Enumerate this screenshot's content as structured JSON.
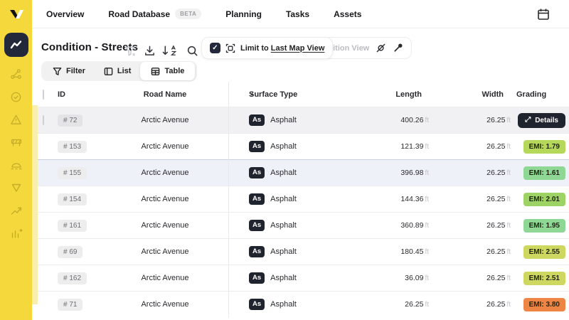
{
  "nav": {
    "items": [
      {
        "label": "Overview"
      },
      {
        "label": "Road Database",
        "badge": "BETA"
      },
      {
        "label": "Planning"
      },
      {
        "label": "Tasks"
      },
      {
        "label": "Assets"
      }
    ]
  },
  "sidebar": {
    "icons": [
      "condition-chart",
      "share-nodes",
      "check-circle",
      "warning-triangle",
      "road-barrier",
      "speed-bump",
      "cone",
      "route",
      "chart-add"
    ]
  },
  "toolbar": {
    "title": "Condition - Streets",
    "limit_toggle": {
      "checked": true,
      "prefix": "Limit to ",
      "link": "Last Map View"
    },
    "condition_view": {
      "label": "Condition View"
    }
  },
  "tabs": {
    "items": [
      {
        "label": "Filter"
      },
      {
        "label": "List"
      },
      {
        "label": "Table"
      }
    ],
    "active_index": 2
  },
  "table": {
    "columns": {
      "id": "ID",
      "road_name": "Road Name",
      "surface_type": "Surface Type",
      "length": "Length",
      "width": "Width",
      "grading": "Grading"
    },
    "unit": "ft",
    "rows": [
      {
        "id": "# 72",
        "road_name": "Arctic Avenue",
        "surface_code": "As",
        "surface": "Asphalt",
        "length": "400.26",
        "width": "26.25",
        "action": "Details",
        "state": "hover",
        "checkbox": true
      },
      {
        "id": "# 153",
        "road_name": "Arctic Avenue",
        "surface_code": "As",
        "surface": "Asphalt",
        "length": "121.39",
        "width": "26.25",
        "emi": "EMI: 1.79",
        "emi_color": "#b6d85a",
        "state": "default"
      },
      {
        "id": "# 155",
        "road_name": "Arctic Avenue",
        "surface_code": "As",
        "surface": "Asphalt",
        "length": "396.98",
        "width": "26.25",
        "emi": "EMI: 1.61",
        "emi_color": "#8ed795",
        "state": "selected"
      },
      {
        "id": "# 154",
        "road_name": "Arctic Avenue",
        "surface_code": "As",
        "surface": "Asphalt",
        "length": "144.36",
        "width": "26.25",
        "emi": "EMI: 2.01",
        "emi_color": "#9dd365",
        "state": "default"
      },
      {
        "id": "# 161",
        "road_name": "Arctic Avenue",
        "surface_code": "As",
        "surface": "Asphalt",
        "length": "360.89",
        "width": "26.25",
        "emi": "EMI: 1.95",
        "emi_color": "#8ed795",
        "state": "default"
      },
      {
        "id": "# 69",
        "road_name": "Arctic Avenue",
        "surface_code": "As",
        "surface": "Asphalt",
        "length": "180.45",
        "width": "26.25",
        "emi": "EMI: 2.55",
        "emi_color": "#ced860",
        "state": "default"
      },
      {
        "id": "# 162",
        "road_name": "Arctic Avenue",
        "surface_code": "As",
        "surface": "Asphalt",
        "length": "36.09",
        "width": "26.25",
        "emi": "EMI: 2.51",
        "emi_color": "#ced860",
        "state": "default"
      },
      {
        "id": "# 71",
        "road_name": "Arctic Avenue",
        "surface_code": "As",
        "surface": "Asphalt",
        "length": "26.25",
        "width": "26.25",
        "emi": "EMI: 3.80",
        "emi_color": "#ee8544",
        "state": "default"
      }
    ]
  },
  "colors": {
    "sidebar_yellow": "#F5D83B",
    "map_strip": "#F8EFAF",
    "dark": "#20242E",
    "selected_row_bg": "#EEF1F8",
    "hover_row_bg": "#F1F1F3"
  }
}
